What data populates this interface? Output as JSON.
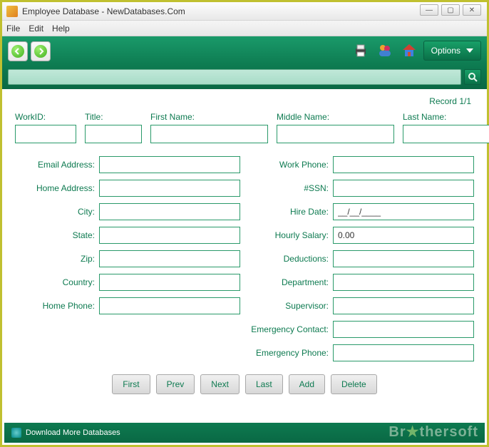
{
  "window": {
    "title": "Employee Database - NewDatabases.Com"
  },
  "menu": {
    "file": "File",
    "edit": "Edit",
    "help": "Help"
  },
  "toolbar": {
    "options_label": "Options"
  },
  "status": {
    "record": "Record 1/1"
  },
  "top_fields": {
    "workid": {
      "label": "WorkID:",
      "value": ""
    },
    "title": {
      "label": "Title:",
      "value": ""
    },
    "first_name": {
      "label": "First Name:",
      "value": ""
    },
    "middle_name": {
      "label": "Middle Name:",
      "value": ""
    },
    "last_name": {
      "label": "Last Name:",
      "value": ""
    }
  },
  "left_fields": [
    {
      "label": "Email Address:",
      "value": ""
    },
    {
      "label": "Home Address:",
      "value": ""
    },
    {
      "label": "City:",
      "value": ""
    },
    {
      "label": "State:",
      "value": ""
    },
    {
      "label": "Zip:",
      "value": ""
    },
    {
      "label": "Country:",
      "value": ""
    },
    {
      "label": "Home Phone:",
      "value": ""
    }
  ],
  "right_fields": [
    {
      "label": "Work Phone:",
      "value": ""
    },
    {
      "label": "#SSN:",
      "value": ""
    },
    {
      "label": "Hire Date:",
      "value": "__/__/____"
    },
    {
      "label": "Hourly Salary:",
      "value": "0.00"
    },
    {
      "label": "Deductions:",
      "value": ""
    },
    {
      "label": "Department:",
      "value": ""
    },
    {
      "label": "Supervisor:",
      "value": ""
    },
    {
      "label": "Emergency Contact:",
      "value": ""
    },
    {
      "label": "Emergency Phone:",
      "value": ""
    }
  ],
  "buttons": {
    "first": "First",
    "prev": "Prev",
    "next": "Next",
    "last": "Last",
    "add": "Add",
    "delete": "Delete"
  },
  "footer": {
    "download": "Download More Databases"
  },
  "watermark": {
    "brand": "Br",
    "star": "★",
    "rest": "thersoft"
  }
}
